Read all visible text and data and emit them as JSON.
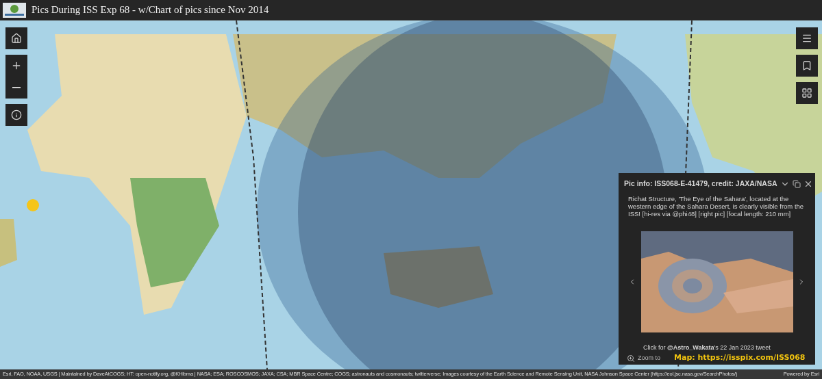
{
  "header": {
    "title": "Pics During ISS Exp 68 - w/Chart of pics since Nov 2014"
  },
  "popup": {
    "title": "Pic info: ISS068-E-41479, credit: JAXA/NASA",
    "description": "Richat Structure, 'The Eye of the Sahara', located at the western edge of the Sahara Desert, is clearly visible from the ISS! [hi-res via @phi48] [right pic] [focal length: 210 mm]",
    "caption": "Click for **@Astro_Wakata**'s 22 Jan 2023 tweet",
    "zoom_button": "Zoom to",
    "map_link": "Map:  https://isspix.com/ISS068"
  },
  "attribution": {
    "text": "Esri, FAO, NOAA, USGS | Maintained by DaveAtCOGS; HT: open-notify.org, @KHibma | NASA; ESA; ROSCOSMOS; JAXA; CSA; MBR Space Centre; COGS; astronauts and cosmonauts; twitterverse; Images courtesy of the Earth Science and Remote Sensing Unit, NASA Johnson Space Center (https://eol.jsc.nasa.gov/SearchPhotos/)",
    "powered_by": "Powered by Esri"
  }
}
